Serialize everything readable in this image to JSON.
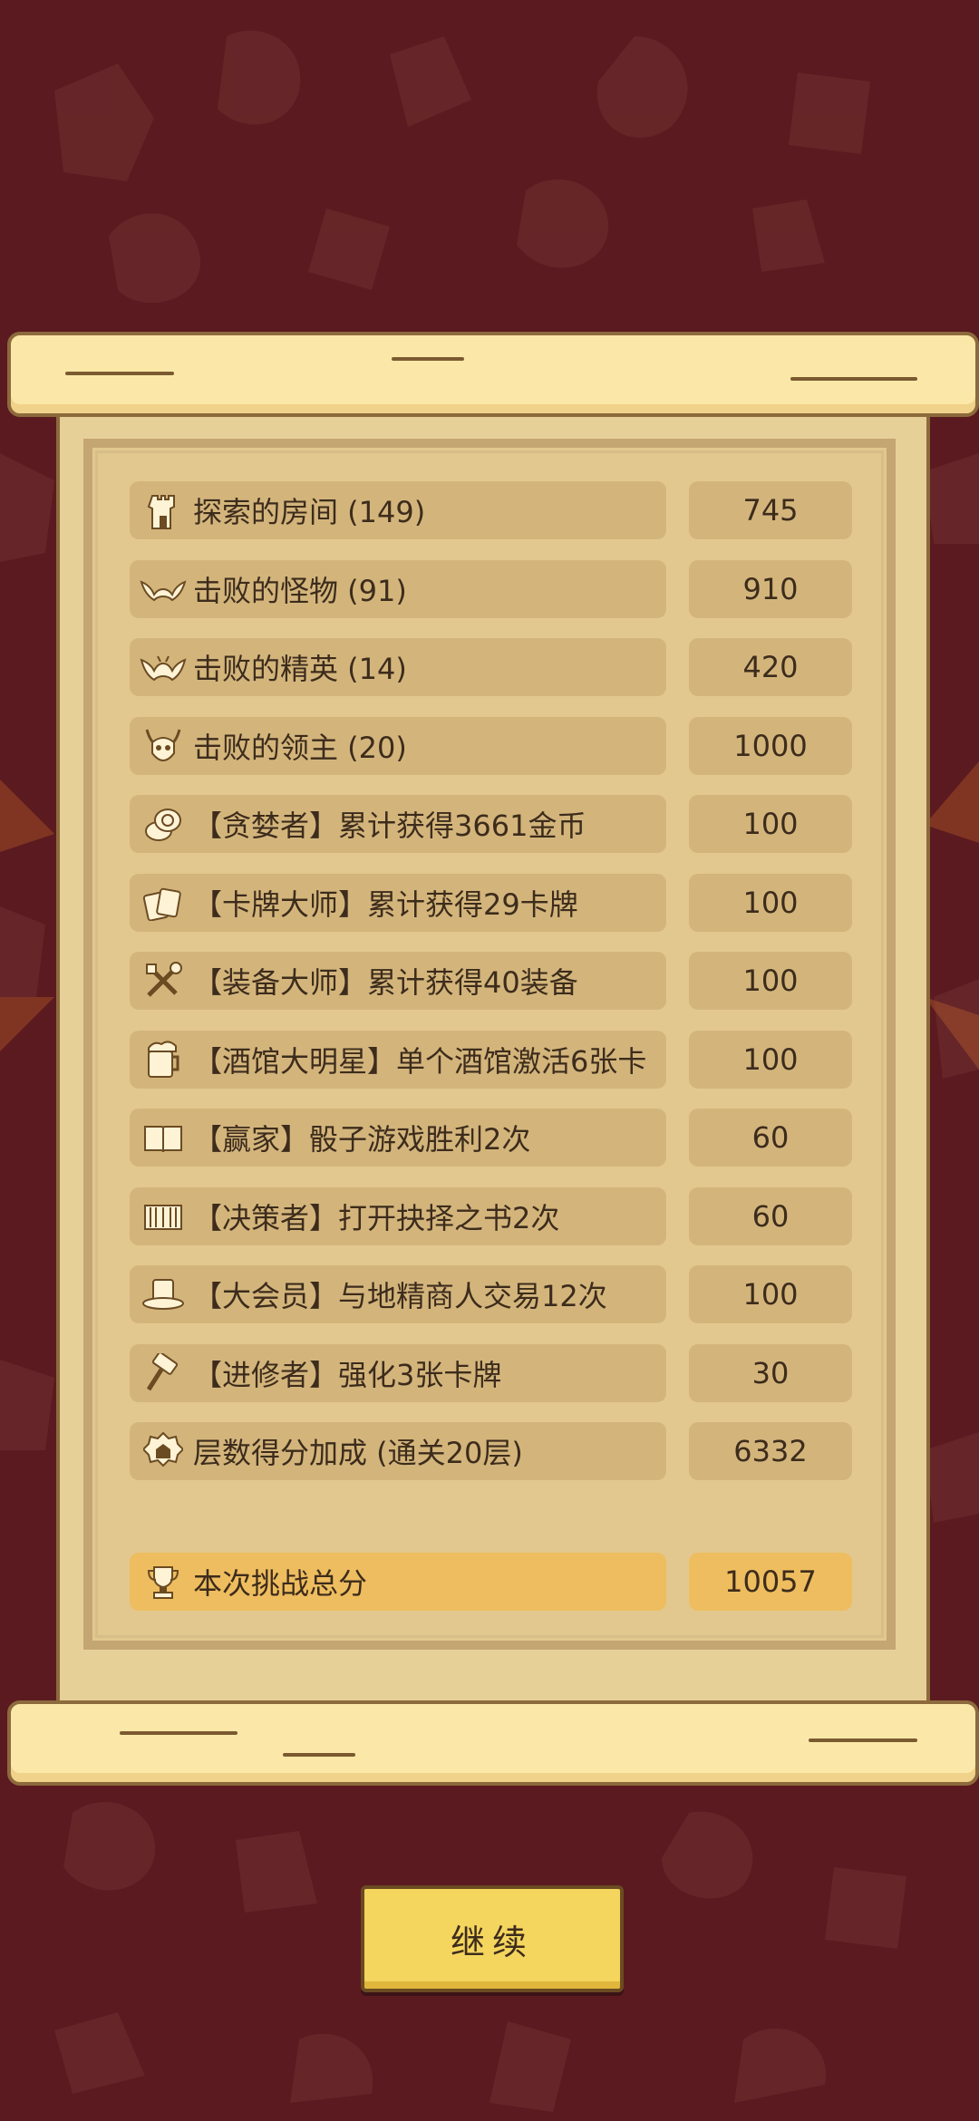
{
  "rows": [
    {
      "icon": "castle-tower-icon",
      "label": "探索的房间 (149)",
      "value": "745"
    },
    {
      "icon": "bat-icon",
      "label": "击败的怪物 (91)",
      "value": "910"
    },
    {
      "icon": "demon-bat-icon",
      "label": "击败的精英 (14)",
      "value": "420"
    },
    {
      "icon": "horned-skull-icon",
      "label": "击败的领主 (20)",
      "value": "1000"
    },
    {
      "icon": "gold-coins-icon",
      "label": "【贪婪者】累计获得3661金币",
      "value": "100"
    },
    {
      "icon": "playing-cards-icon",
      "label": "【卡牌大师】累计获得29卡牌",
      "value": "100"
    },
    {
      "icon": "crossed-weapons-icon",
      "label": "【装备大师】累计获得40装备",
      "value": "100"
    },
    {
      "icon": "beer-mug-icon",
      "label": "【酒馆大明星】单个酒馆激活6张卡",
      "value": "100"
    },
    {
      "icon": "open-book-icon",
      "label": "【赢家】骰子游戏胜利2次",
      "value": "60"
    },
    {
      "icon": "book-of-choices-icon",
      "label": "【决策者】打开抉择之书2次",
      "value": "60"
    },
    {
      "icon": "top-hat-icon",
      "label": "【大会员】与地精商人交易12次",
      "value": "100"
    },
    {
      "icon": "hammer-icon",
      "label": "【进修者】强化3张卡牌",
      "value": "30"
    },
    {
      "icon": "floor-badge-icon",
      "label": "层数得分加成 (通关20层)",
      "value": "6332"
    }
  ],
  "total": {
    "icon": "trophy-icon",
    "label": "本次挑战总分",
    "value": "10057"
  },
  "continue_label": "继续",
  "colors": {
    "background": "#5b1a1f",
    "parchment": "#e7cf98",
    "row": "#d3b57c",
    "total_row": "#eebd5f",
    "button": "#f4d55e",
    "text": "#3d2c1c"
  }
}
